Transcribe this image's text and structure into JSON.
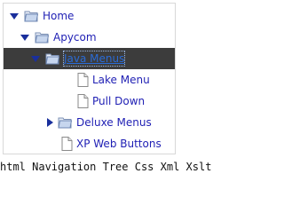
{
  "tree": {
    "items": [
      {
        "label": "Home",
        "icon": "folder-icon",
        "toggle": "expanded",
        "selected": false
      },
      {
        "label": "Apycom",
        "icon": "folder-icon",
        "toggle": "expanded",
        "selected": false
      },
      {
        "label": "Java Menus",
        "icon": "folder-icon",
        "toggle": "expanded",
        "selected": true
      },
      {
        "label": "Lake Menu",
        "icon": "page-icon",
        "toggle": "none",
        "selected": false
      },
      {
        "label": "Pull Down",
        "icon": "page-icon",
        "toggle": "none",
        "selected": false
      },
      {
        "label": "Deluxe Menus",
        "icon": "folder-icon",
        "toggle": "collapsed",
        "selected": false
      },
      {
        "label": "XP Web Buttons",
        "icon": "page-icon",
        "toggle": "none",
        "selected": false
      }
    ]
  },
  "caption": "html Navigation Tree Css Xml Xslt",
  "colors": {
    "label": "#1f1fb4",
    "selected_bg": "#3c3c3c",
    "selected_label": "#2a6bd6",
    "toggle_arrow": "#1a2f9c"
  }
}
